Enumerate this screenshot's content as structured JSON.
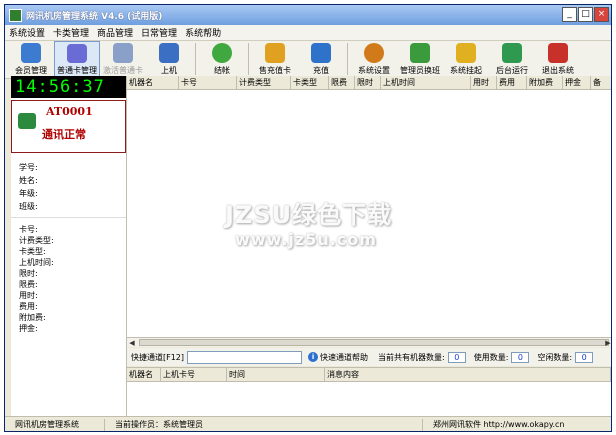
{
  "window": {
    "title": "网讯机房管理系统  V4.6 (试用版)",
    "btn_min": "_",
    "btn_max": "□",
    "btn_close": "×"
  },
  "menu": [
    "系统设置",
    "卡类管理",
    "商品管理",
    "日常管理",
    "系统帮助"
  ],
  "toolbar": [
    {
      "label": "会员管理",
      "icon": "members-icon",
      "color": "#3d7bd1",
      "state": "normal"
    },
    {
      "label": "普通卡管理",
      "icon": "card-manage-icon",
      "color": "#6b6bd6",
      "state": "active"
    },
    {
      "label": "激活普通卡",
      "icon": "activate-card-icon",
      "color": "#8aa0c8",
      "state": "disabled"
    },
    {
      "label": "上机",
      "icon": "computer-icon",
      "color": "#3a6fc4",
      "state": "normal"
    },
    {
      "label": "结帐",
      "icon": "checkout-icon",
      "color": "#3fa83f",
      "state": "normal"
    },
    {
      "label": "售充值卡",
      "icon": "sell-card-icon",
      "color": "#e0a020",
      "state": "normal"
    },
    {
      "label": "充值",
      "icon": "recharge-icon",
      "color": "#2f72c9",
      "state": "normal"
    },
    {
      "label": "系统设置",
      "icon": "settings-icon",
      "color": "#d07a1a",
      "state": "normal"
    },
    {
      "label": "管理员换班",
      "icon": "shift-change-icon",
      "color": "#3b9a3b",
      "state": "normal"
    },
    {
      "label": "系统挂起",
      "icon": "lock-icon",
      "color": "#e0b020",
      "state": "normal"
    },
    {
      "label": "后台运行",
      "icon": "background-run-icon",
      "color": "#2f9a4f",
      "state": "normal"
    },
    {
      "label": "退出系统",
      "icon": "exit-icon",
      "color": "#c8302a",
      "state": "normal"
    }
  ],
  "clock": "14:56:37",
  "station": {
    "id": "AT0001",
    "status": "通讯正常"
  },
  "user_info": [
    "学号:",
    "姓名:",
    "年级:",
    "班级:"
  ],
  "card_info": [
    "卡号:",
    "计费类型:",
    "卡类型:",
    "上机时间:",
    "限时:",
    "限费:",
    "用时:",
    "费用:",
    "附加费:",
    "押金:"
  ],
  "main_columns": [
    "机器名",
    "卡号",
    "计费类型",
    "卡类型",
    "限费",
    "限时",
    "上机时间",
    "用时",
    "费用",
    "附加费",
    "押金",
    "备"
  ],
  "quickbar": {
    "channel_label": "快捷通道[F12]",
    "help_label": "快速通道帮助",
    "machines_label": "当前共有机器数量:",
    "machines_count": "0",
    "used_label": "使用数量:",
    "used_count": "0",
    "idle_label": "空闲数量:",
    "idle_count": "0"
  },
  "msg_columns": [
    "机器名",
    "上机卡号",
    "时间",
    "消息内容"
  ],
  "statusbar": [
    "网讯机房管理系统",
    "当前操作员：系统管理员",
    "郑州网讯软件 http://www.okapy.cn"
  ],
  "watermark": {
    "line1": "JZSU绿色下载",
    "line2": "www.jz5u.com"
  }
}
